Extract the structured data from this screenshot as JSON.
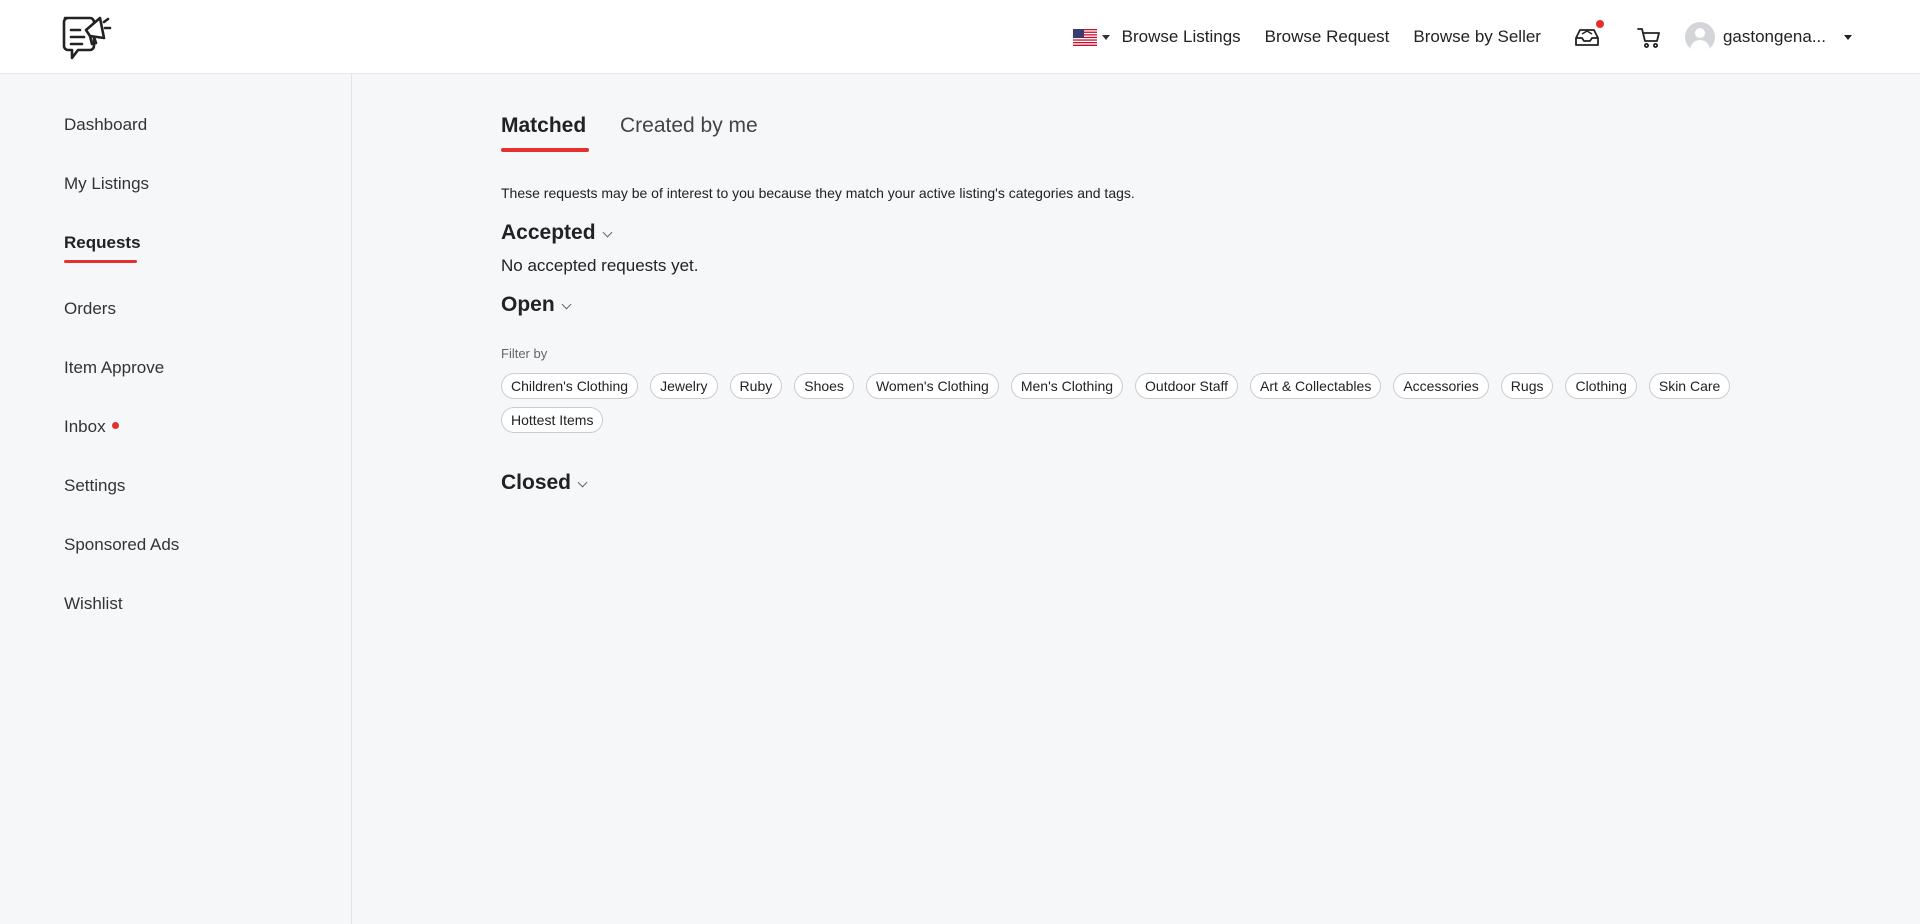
{
  "header": {
    "logo": "megaphone-chat-logo",
    "nav": {
      "browse_listings": "Browse Listings",
      "browse_request": "Browse Request",
      "browse_by_seller": "Browse by Seller"
    },
    "username": "gastongena...",
    "flag": "us-flag-icon",
    "inbox_icon": "inbox-tray-icon",
    "cart_icon": "cart-icon"
  },
  "sidebar": {
    "items": [
      {
        "label": "Dashboard"
      },
      {
        "label": "My Listings"
      },
      {
        "label": "Requests"
      },
      {
        "label": "Orders"
      },
      {
        "label": "Item Approve"
      },
      {
        "label": "Inbox"
      },
      {
        "label": "Settings"
      },
      {
        "label": "Sponsored Ads"
      },
      {
        "label": "Wishlist"
      }
    ],
    "active": "Requests"
  },
  "main": {
    "tabs": [
      {
        "label": "Matched"
      },
      {
        "label": "Created by me"
      }
    ],
    "active_tab": "Matched",
    "intro": "These requests may be of interest to you because they match your active listing's categories and tags.",
    "sections": {
      "accepted": "Accepted",
      "accepted_empty": "No accepted requests yet.",
      "open": "Open",
      "closed": "Closed"
    },
    "filter_label": "Filter by",
    "filters": [
      "Children's Clothing",
      "Jewelry",
      "Ruby",
      "Shoes",
      "Women's Clothing",
      "Men's Clothing",
      "Outdoor Staff",
      "Art & Collectables",
      "Accessories",
      "Rugs",
      "Clothing",
      "Skin Care",
      "Hottest Items"
    ]
  },
  "colors": {
    "accent": "#e3312d",
    "background": "#f6f7f9",
    "header_bg": "#ffffff"
  }
}
